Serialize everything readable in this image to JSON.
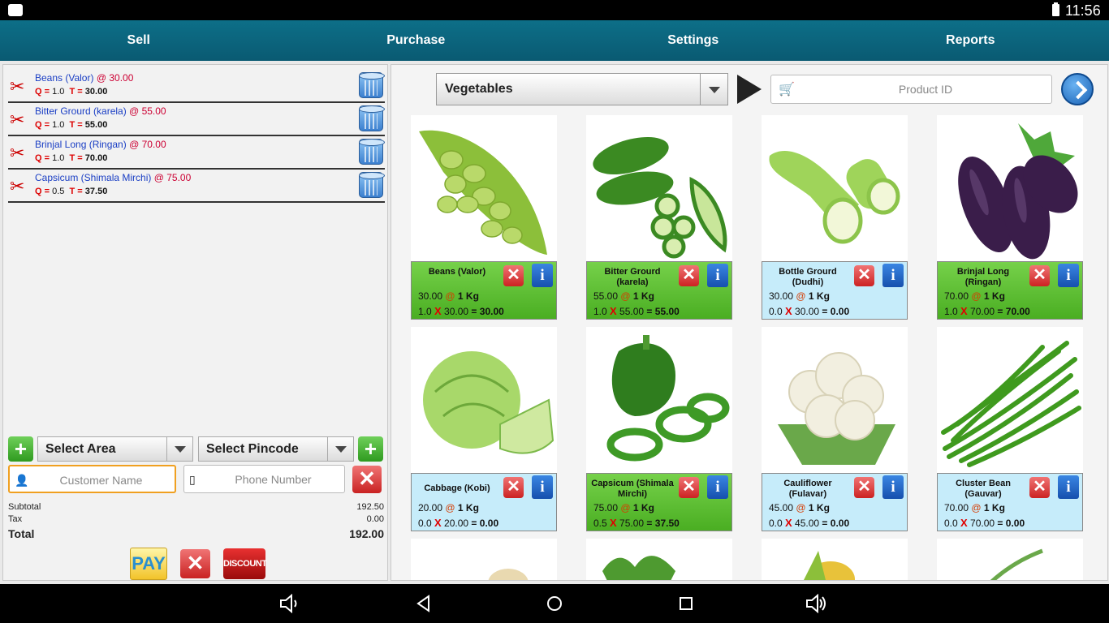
{
  "status": {
    "time": "11:56"
  },
  "nav": {
    "tabs": [
      "Sell",
      "Purchase",
      "Settings",
      "Reports"
    ]
  },
  "cart": {
    "items": [
      {
        "name": "Beans (Valor)",
        "price": "@ 30.00",
        "q_label": "Q =",
        "q": "1.0",
        "t_label": "T =",
        "t": "30.00"
      },
      {
        "name": "Bitter Grourd (karela)",
        "price": "@ 55.00",
        "q_label": "Q =",
        "q": "1.0",
        "t_label": "T =",
        "t": "55.00"
      },
      {
        "name": "Brinjal Long (Ringan)",
        "price": "@ 70.00",
        "q_label": "Q =",
        "q": "1.0",
        "t_label": "T =",
        "t": "70.00"
      },
      {
        "name": "Capsicum (Shimala Mirchi)",
        "price": "@ 75.00",
        "q_label": "Q =",
        "q": "0.5",
        "t_label": "T =",
        "t": "37.50"
      }
    ],
    "select_area": "Select Area",
    "select_pincode": "Select Pincode",
    "customer_placeholder": "Customer Name",
    "phone_placeholder": "Phone Number",
    "subtotal_label": "Subtotal",
    "subtotal": "192.50",
    "tax_label": "Tax",
    "tax": "0.00",
    "total_label": "Total",
    "total": "192.00",
    "pay_label": "PAY",
    "discount_label": "DISCOUNT"
  },
  "products_panel": {
    "category": "Vegetables",
    "product_id_placeholder": "Product ID",
    "products": [
      {
        "name": "Beans (Valor)",
        "rate": "30.00",
        "at": "@",
        "unit_text": "1 Kg",
        "qty": "1.0",
        "x": "X",
        "rate2": "30.00",
        "total": "= 30.00",
        "selected": true
      },
      {
        "name": "Bitter Grourd (karela)",
        "rate": "55.00",
        "at": "@",
        "unit_text": "1 Kg",
        "qty": "1.0",
        "x": "X",
        "rate2": "55.00",
        "total": "= 55.00",
        "selected": true
      },
      {
        "name": "Bottle Grourd (Dudhi)",
        "rate": "30.00",
        "at": "@",
        "unit_text": "1 Kg",
        "qty": "0.0",
        "x": "X",
        "rate2": "30.00",
        "total": "= 0.00",
        "selected": false
      },
      {
        "name": "Brinjal Long (Ringan)",
        "rate": "70.00",
        "at": "@",
        "unit_text": "1 Kg",
        "qty": "1.0",
        "x": "X",
        "rate2": "70.00",
        "total": "= 70.00",
        "selected": true
      },
      {
        "name": "Cabbage (Kobi)",
        "rate": "20.00",
        "at": "@",
        "unit_text": "1 Kg",
        "qty": "0.0",
        "x": "X",
        "rate2": "20.00",
        "total": "= 0.00",
        "selected": false
      },
      {
        "name": "Capsicum (Shimala Mirchi)",
        "rate": "75.00",
        "at": "@",
        "unit_text": "1 Kg",
        "qty": "0.5",
        "x": "X",
        "rate2": "75.00",
        "total": "= 37.50",
        "selected": true
      },
      {
        "name": "Cauliflower (Fulavar)",
        "rate": "45.00",
        "at": "@",
        "unit_text": "1 Kg",
        "qty": "0.0",
        "x": "X",
        "rate2": "45.00",
        "total": "= 0.00",
        "selected": false
      },
      {
        "name": "Cluster Bean (Gauvar)",
        "rate": "70.00",
        "at": "@",
        "unit_text": "1 Kg",
        "qty": "0.0",
        "x": "X",
        "rate2": "70.00",
        "total": "= 0.00",
        "selected": false
      }
    ]
  },
  "icons": {
    "scissors": "scissors-icon",
    "trash": "trash-can-icon",
    "cart": "cart-icon",
    "go": "go-arrow-icon",
    "remove": "close-icon",
    "info": "info-icon",
    "add_person": "add-person-icon",
    "phone": "phone-icon"
  },
  "colors": {
    "nav_bg": "#0d6f88",
    "selected_card": "#5ec033",
    "unselected_card": "#c6ecfa",
    "price_accent": "#d00000"
  }
}
